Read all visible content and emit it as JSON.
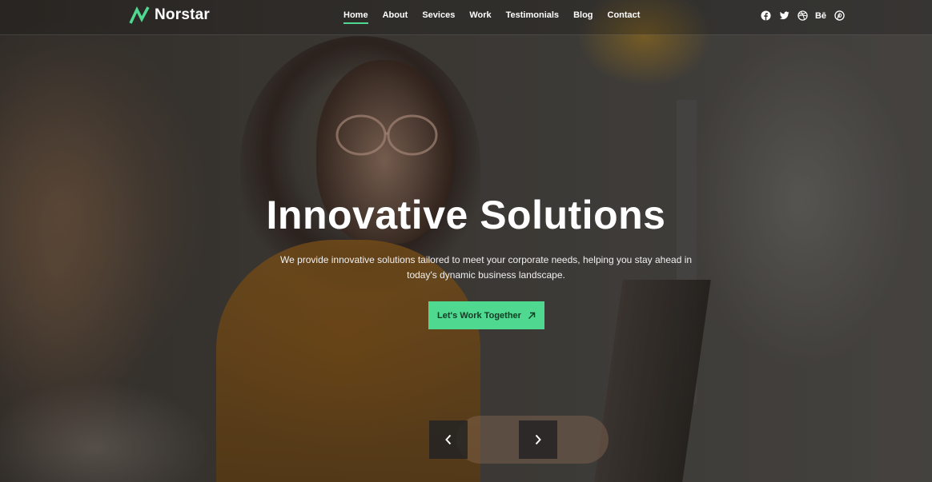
{
  "brand": {
    "name": "Norstar",
    "accent_color": "#4fd88f"
  },
  "nav": {
    "items": [
      {
        "label": "Home",
        "active": true
      },
      {
        "label": "About"
      },
      {
        "label": "Sevices"
      },
      {
        "label": "Work"
      },
      {
        "label": "Testimonials"
      },
      {
        "label": "Blog"
      },
      {
        "label": "Contact"
      }
    ]
  },
  "social": {
    "icons": [
      "facebook-icon",
      "twitter-icon",
      "dribbble-icon",
      "behance-icon",
      "pinterest-icon"
    ],
    "behance_label": "Bē"
  },
  "hero": {
    "title": "Innovative Solutions",
    "subtitle": "We provide innovative solutions tailored to meet your corporate needs, helping you stay ahead in today's dynamic business landscape.",
    "cta_label": "Let's Work Together"
  },
  "slider": {
    "prev_icon": "chevron-left-icon",
    "next_icon": "chevron-right-icon"
  }
}
